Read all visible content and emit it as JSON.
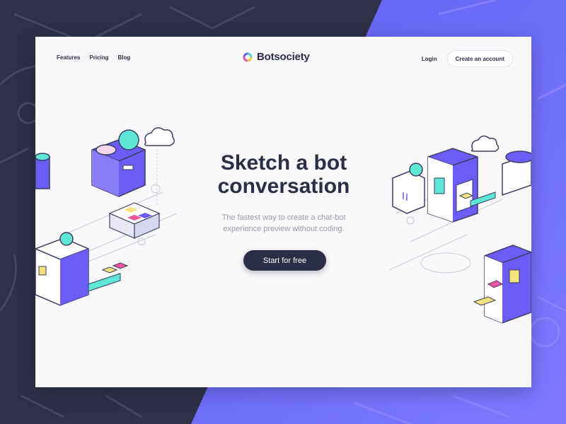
{
  "nav": {
    "links": [
      "Features",
      "Pricing",
      "Blog"
    ],
    "login": "Login",
    "create_account": "Create an account"
  },
  "brand": {
    "name": "Botsociety",
    "logo_icon": "ring-logo-icon"
  },
  "hero": {
    "title_line1": "Sketch a bot",
    "title_line2": "conversation",
    "subtitle_line1": "The fastest way to create a chat-bot",
    "subtitle_line2": "experience preview without coding.",
    "cta": "Start for free"
  },
  "colors": {
    "dark": "#2b2f45",
    "accent": "#5c5ef0",
    "teal": "#5ee6d6",
    "yellow": "#f6e27a",
    "pink": "#f0569b"
  }
}
